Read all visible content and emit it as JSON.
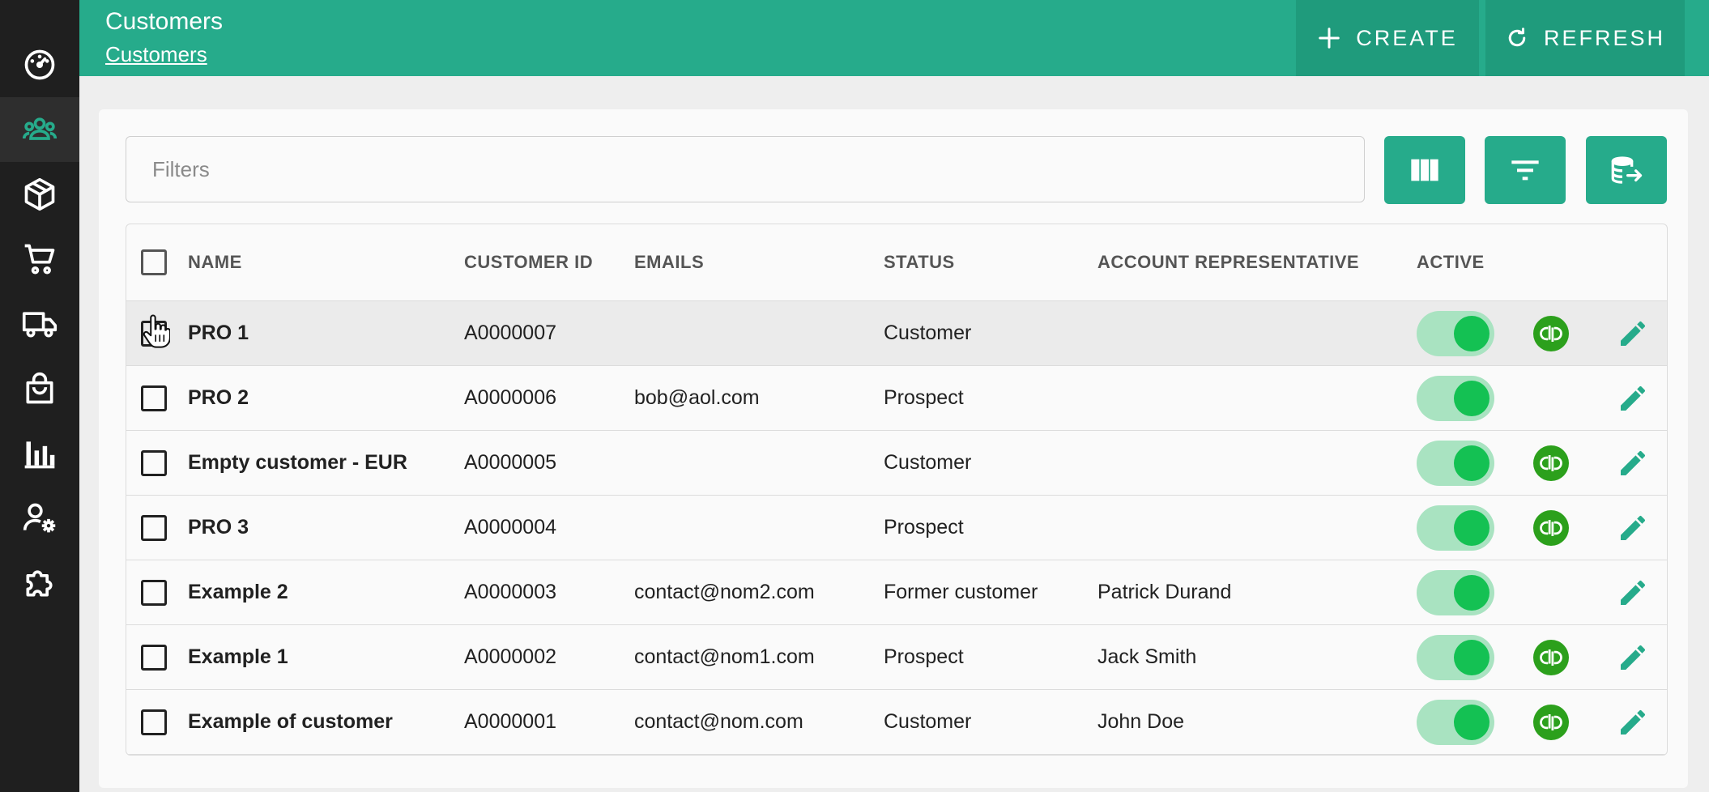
{
  "app": {
    "page_title": "Customers",
    "breadcrumb": "Customers",
    "accent_color": "#26ab8b"
  },
  "sidebar": {
    "items": [
      {
        "icon": "dashboard-gauge-icon",
        "active": false
      },
      {
        "icon": "customers-group-icon",
        "active": true
      },
      {
        "icon": "product-box-icon",
        "active": false
      },
      {
        "icon": "shopping-cart-icon",
        "active": false
      },
      {
        "icon": "delivery-truck-icon",
        "active": false
      },
      {
        "icon": "shopping-bag-icon",
        "active": false
      },
      {
        "icon": "bar-chart-icon",
        "active": false
      },
      {
        "icon": "user-settings-icon",
        "active": false
      },
      {
        "icon": "puzzle-extension-icon",
        "active": false
      }
    ]
  },
  "toolbar": {
    "create_label": "CREATE",
    "refresh_label": "REFRESH"
  },
  "filters": {
    "placeholder": "Filters",
    "buttons": [
      "columns-icon",
      "filter-list-icon",
      "database-export-icon"
    ]
  },
  "table": {
    "columns": [
      "NAME",
      "CUSTOMER ID",
      "EMAILS",
      "STATUS",
      "ACCOUNT REPRESENTATIVE",
      "ACTIVE"
    ],
    "rows": [
      {
        "name": "PRO 1",
        "id": "A0000007",
        "email": "",
        "status": "Customer",
        "rep": "",
        "active": true,
        "quickbooks": true
      },
      {
        "name": "PRO 2",
        "id": "A0000006",
        "email": "bob@aol.com",
        "status": "Prospect",
        "rep": "",
        "active": true,
        "quickbooks": false
      },
      {
        "name": "Empty customer - EUR",
        "id": "A0000005",
        "email": "",
        "status": "Customer",
        "rep": "",
        "active": true,
        "quickbooks": true
      },
      {
        "name": "PRO 3",
        "id": "A0000004",
        "email": "",
        "status": "Prospect",
        "rep": "",
        "active": true,
        "quickbooks": true
      },
      {
        "name": "Example 2",
        "id": "A0000003",
        "email": "contact@nom2.com",
        "status": "Former customer",
        "rep": "Patrick Durand",
        "active": true,
        "quickbooks": false
      },
      {
        "name": "Example 1",
        "id": "A0000002",
        "email": "contact@nom1.com",
        "status": "Prospect",
        "rep": "Jack Smith",
        "active": true,
        "quickbooks": true
      },
      {
        "name": "Example of customer",
        "id": "A0000001",
        "email": "contact@nom.com",
        "status": "Customer",
        "rep": "John Doe",
        "active": true,
        "quickbooks": true
      }
    ]
  }
}
